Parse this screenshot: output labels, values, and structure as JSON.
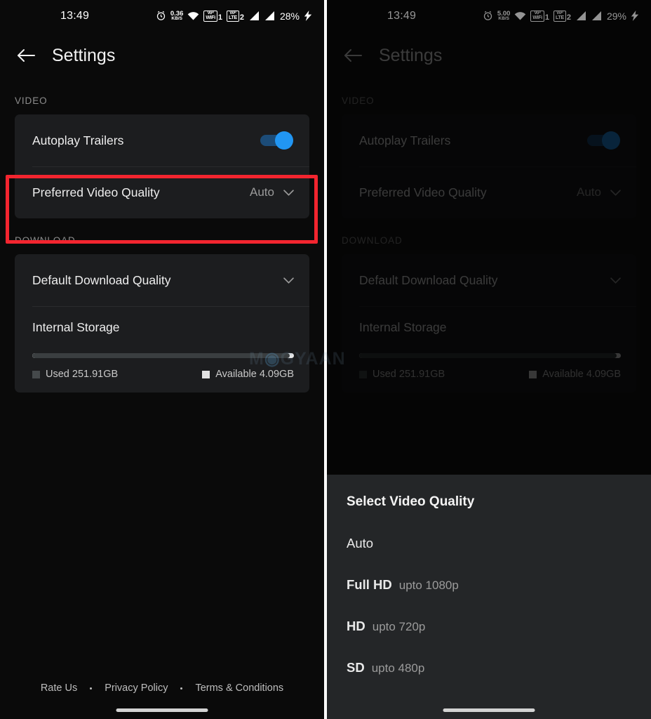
{
  "left": {
    "status_bar": {
      "time": "13:49",
      "alarm_icon": "alarm-clock-icon",
      "net_speed_value": "0.36",
      "net_speed_unit": "KB/S",
      "wifi_icon": "wifi-icon",
      "volte_wifi_top": "Voᴿ",
      "volte_wifi_bottom": "WiFi",
      "volte_wifi_sim": "1",
      "volte_lte_top": "Voᴿ",
      "volte_lte_bottom": "LTE",
      "volte_lte_sim": "2",
      "signal_icon_1": "signal-bars-icon",
      "signal_icon_2": "signal-bars-icon",
      "battery": "28%",
      "charging_icon": "charging-bolt-icon"
    },
    "appbar": {
      "back_icon": "back-arrow-icon",
      "title": "Settings"
    },
    "video_section": {
      "label": "VIDEO",
      "autoplay_label": "Autoplay Trailers",
      "autoplay_on": true,
      "preferred_quality_label": "Preferred Video Quality",
      "preferred_quality_value": "Auto",
      "chevron_icon": "chevron-down-icon"
    },
    "download_section": {
      "label": "DOWNLOAD",
      "default_quality_label": "Default Download Quality",
      "chevron_icon": "chevron-down-icon",
      "storage_title": "Internal Storage",
      "used_percent": 98.4,
      "used_label": "Used 251.91GB",
      "available_label": "Available 4.09GB"
    },
    "footer": {
      "rate_us": "Rate Us",
      "privacy_policy": "Privacy Policy",
      "terms": "Terms & Conditions"
    },
    "highlight": {
      "color": "#f3252f",
      "target": "preferred-video-quality-row"
    }
  },
  "right": {
    "status_bar": {
      "time": "13:49",
      "alarm_icon": "alarm-clock-icon",
      "net_speed_value": "5.00",
      "net_speed_unit": "KB/S",
      "wifi_icon": "wifi-icon",
      "volte_wifi_top": "Voᴿ",
      "volte_wifi_bottom": "WiFi",
      "volte_wifi_sim": "1",
      "volte_lte_top": "Voᴿ",
      "volte_lte_bottom": "LTE",
      "volte_lte_sim": "2",
      "signal_icon_1": "signal-bars-icon",
      "signal_icon_2": "signal-bars-icon",
      "battery": "29%",
      "charging_icon": "charging-bolt-icon"
    },
    "appbar": {
      "back_icon": "back-arrow-icon",
      "title": "Settings"
    },
    "video_section": {
      "label": "VIDEO",
      "autoplay_label": "Autoplay Trailers",
      "autoplay_on": true,
      "preferred_quality_label": "Preferred Video Quality",
      "preferred_quality_value": "Auto",
      "chevron_icon": "chevron-down-icon"
    },
    "download_section": {
      "label": "DOWNLOAD",
      "default_quality_label": "Default Download Quality",
      "chevron_icon": "chevron-down-icon",
      "storage_title": "Internal Storage",
      "used_percent": 98.4,
      "used_label": "Used 251.91GB",
      "available_label": "Available 4.09GB"
    },
    "sheet": {
      "title": "Select Video Quality",
      "options": [
        {
          "name": "Auto",
          "sub": ""
        },
        {
          "name": "Full HD",
          "sub": "upto 1080p"
        },
        {
          "name": "HD",
          "sub": "upto 720p"
        },
        {
          "name": "SD",
          "sub": "upto 480p"
        }
      ]
    }
  },
  "watermark": {
    "text_a": "M",
    "text_b": "GYAAN"
  },
  "colors": {
    "accent_blue": "#2196f3",
    "highlight_red": "#f3252f",
    "card_bg": "#1c1d1f",
    "screen_bg": "#0a0a0a",
    "sheet_bg": "#242628"
  }
}
